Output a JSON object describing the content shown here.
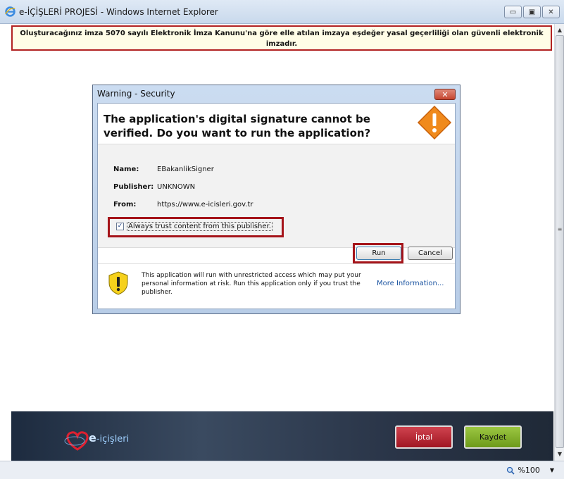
{
  "window": {
    "title": "e-İÇİŞLERİ PROJESİ - Windows Internet Explorer",
    "minimize_glyph": "▭",
    "maximize_glyph": "▣",
    "close_glyph": "✕"
  },
  "page": {
    "notice": "Oluşturacağınız imza 5070 sayılı Elektronik İmza Kanunu'na göre elle atılan imzaya eşdeğer yasal geçerliliği olan güvenli elektronik imzadır."
  },
  "dialog": {
    "title": "Warning - Security",
    "close_glyph": "✕",
    "heading": "The application's digital signature cannot be verified. Do you want to run the application?",
    "fields": [
      {
        "key": "Name:",
        "value": "EBakanlikSigner"
      },
      {
        "key": "Publisher:",
        "value": "UNKNOWN"
      },
      {
        "key": "From:",
        "value": "https://www.e-icisleri.gov.tr"
      }
    ],
    "trust_checkbox": {
      "checked": true,
      "check_glyph": "✓",
      "label": "Always trust content from this publisher."
    },
    "run_label": "Run",
    "cancel_label": "Cancel",
    "footer_text": "This application will run with unrestricted access which may put your personal information at risk. Run this application only if you trust the publisher.",
    "more_info_label": "More Information..."
  },
  "brand": {
    "logo_text_prefix": "e",
    "logo_text_rest": "-içişleri",
    "cancel_label": "İptal",
    "save_label": "Kaydet"
  },
  "statusbar": {
    "zoom": "%100",
    "zoom_dropdown_glyph": "▼"
  },
  "scroll": {
    "up_glyph": "▲",
    "down_glyph": "▼",
    "grip_glyph": "≡"
  },
  "colors": {
    "highlight_red": "#a5141a",
    "iptal_red": "#b8232e",
    "kaydet_green": "#86b32e",
    "link_blue": "#1a53a0"
  }
}
